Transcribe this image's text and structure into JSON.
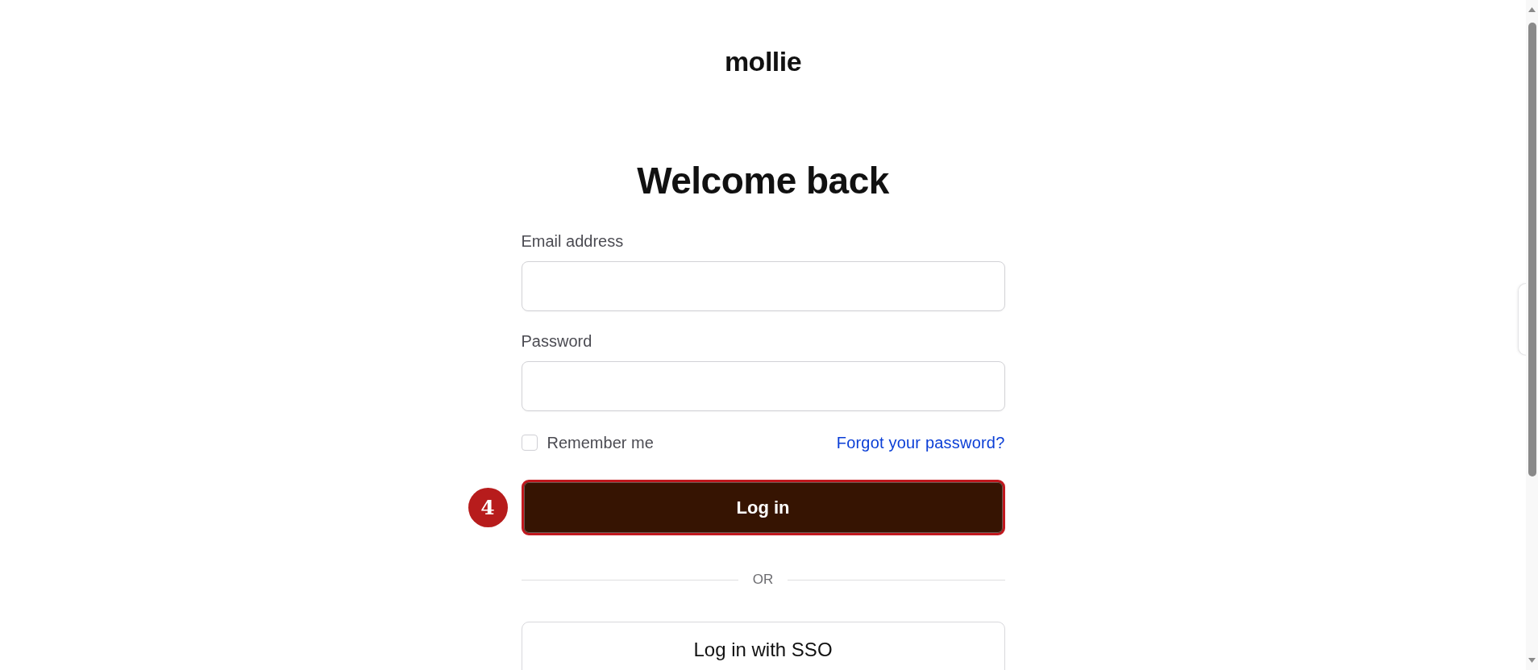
{
  "logo": {
    "text": "mollie"
  },
  "heading": "Welcome back",
  "fields": [
    {
      "label": "Email address"
    },
    {
      "label": "Password"
    }
  ],
  "remember": {
    "label": "Remember me",
    "checked": false
  },
  "forgot_link": "Forgot your password?",
  "login_button": {
    "label": "Log in",
    "highlighted": true,
    "marker": "4"
  },
  "divider": "OR",
  "sso_button": {
    "label": "Log in with SSO"
  }
}
